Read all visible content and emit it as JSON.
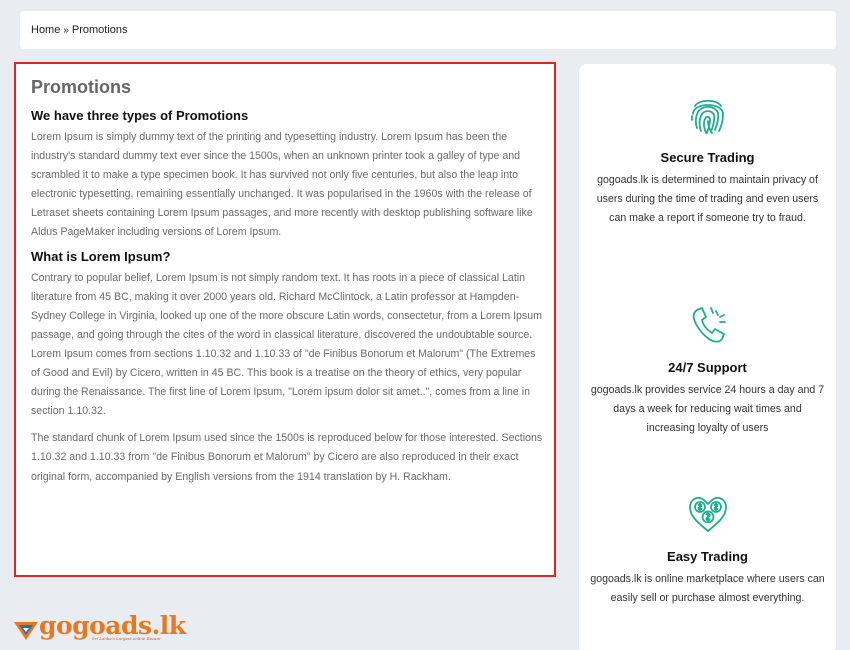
{
  "breadcrumb": {
    "home": "Home",
    "separator": "»",
    "current": "Promotions"
  },
  "main": {
    "title": "Promotions",
    "section1_heading": "We have three types of Promotions",
    "section1_text": "Lorem Ipsum is simply dummy text of the printing and typesetting industry. Lorem Ipsum has been the industry's standard dummy text ever since the 1500s, when an unknown printer took a galley of type and scrambled it to make a type specimen book. It has survived not only five centuries, but also the leap into electronic typesetting, remaining essentially unchanged. It was popularised in the 1960s with the release of Letraset sheets containing Lorem Ipsum passages, and more recently with desktop publishing software like Aldus PageMaker including versions of Lorem Ipsum.",
    "section2_heading": "What is Lorem Ipsum?",
    "section2_text": "Contrary to popular belief, Lorem Ipsum is not simply random text. It has roots in a piece of classical Latin literature from 45 BC, making it over 2000 years old. Richard McClintock, a Latin professor at Hampden-Sydney College in Virginia, looked up one of the more obscure Latin words, consectetur, from a Lorem Ipsum passage, and going through the cites of the word in classical literature, discovered the undoubtable source. Lorem Ipsum comes from sections 1.10.32 and 1.10.33 of \"de Finibus Bonorum et Malorum\" (The Extremes of Good and Evil) by Cicero, written in 45 BC. This book is a treatise on the theory of ethics, very popular during the Renaissance. The first line of Lorem Ipsum, \"Lorem ipsum dolor sit amet..\", comes from a line in section 1.10.32.",
    "section3_text": "The standard chunk of Lorem Ipsum used since the 1500s is reproduced below for those interested. Sections 1.10.32 and 1.10.33 from \"de Finibus Bonorum et Malorum\" by Cicero are also reproduced in their exact original form, accompanied by English versions from the 1914 translation by H. Rackham."
  },
  "features": [
    {
      "icon": "fingerprint-icon",
      "title": "Secure Trading",
      "text": "gogoads.lk is determined to maintain privacy of users during the time of trading and even users can make a report if someone try to fraud."
    },
    {
      "icon": "phone-icon",
      "title": "24/7 Support",
      "text": "gogoads.lk provides service 24 hours a day and 7 days a week for reducing wait times and increasing loyalty of users"
    },
    {
      "icon": "money-heart-icon",
      "title": "Easy Trading",
      "text": "gogoads.lk is online marketplace where users can easily sell or purchase almost everything."
    }
  ],
  "logo": {
    "text": "gogoads.lk",
    "tagline": "Sri Lanka's Largest online Bazaar"
  },
  "colors": {
    "accent_green": "#1fae8c",
    "highlight_border": "#e02424",
    "logo_orange": "#e8781e",
    "page_bg": "#e9edf2"
  }
}
